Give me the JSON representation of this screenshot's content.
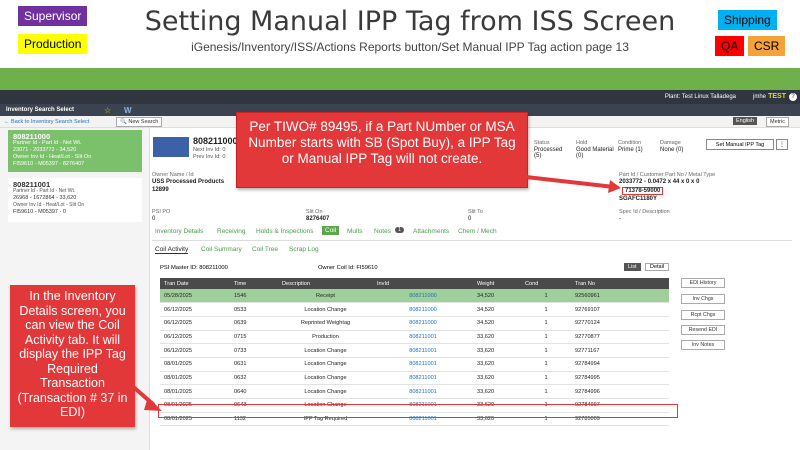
{
  "slide": {
    "title": "Setting Manual IPP Tag from ISS Screen",
    "subtitle": "iGenesis/Inventory/ISS/Actions Reports button/Set Manual IPP Tag action page 13",
    "roles_left": [
      "Supervisor",
      "Production"
    ],
    "roles_right": [
      "Shipping",
      "QA",
      "CSR"
    ]
  },
  "app": {
    "plant": "Plant: Test Linux Talladega",
    "user": "jmhe",
    "env": "TEST",
    "screen_title": "Inventory Search Select",
    "w_icon": "W",
    "back_link": "Back to Inventory Search Select",
    "new_search": "New Search",
    "lang": [
      "English",
      "Metric"
    ]
  },
  "sidebar": {
    "cards": [
      {
        "title": "808211000",
        "l1": "Partner Id - Part Id - Net Wt.",
        "l2": "23071 - 2033772 - 34,520",
        "l3": "Owner Inv Id - Heat/Lot - Slit On",
        "l4": "FI59610 - M05397 - 8276407"
      },
      {
        "title": "808211001",
        "l1": "Partner Id - Part Id - Net Wt.",
        "l2": "26968 - 1672864 - 33,620",
        "l3": "Owner Inv Id - Heat/Lot - Slit On",
        "l4": "FI59610 - M05397 - 0"
      }
    ]
  },
  "detail": {
    "inv_id": "808211000",
    "next_inv": "Next Inv Id: 0",
    "prev_inv": "Prev Inv Id: 0",
    "owner_label": "Owner Name / Id",
    "owner_name": "USS Processed Products",
    "owner_id": "12899",
    "status_label": "Status",
    "status_val": "Processed (5)",
    "hold_label": "Hold",
    "hold_val": "Good Material (0)",
    "cond_label": "Condition",
    "cond_val": "Prime (1)",
    "damage_label": "Damage",
    "damage_val": "None (0)",
    "set_manual_btn": "Set Manual IPP Tag",
    "part_label": "Part Id / Customer Part No / Metal Type",
    "part_val": "2033772 - 0.0472 x 44 x 0 x 0",
    "part_no": "71378-59000",
    "metal": "SGAFC1180Y",
    "psi_po_label": "PSI PO",
    "psi_po_val": "0",
    "slit_on_label": "Slit On",
    "slit_on_val": "8276407",
    "slit_to_label": "Slit To",
    "slit_to_val": "0",
    "spec_label": "Spec Id / Description",
    "spec_val": "-",
    "tabs": [
      "Inventory Details",
      "Receiving",
      "Holds & Inspections",
      "Coil",
      "Mults",
      "Notes",
      "Attachments",
      "Chem / Mech"
    ],
    "notes_count": "1",
    "subtabs": [
      "Coil Activity",
      "Coil Summary",
      "Coil Tree",
      "Scrap Log"
    ],
    "psi_master": "PSI Master ID: 808211000",
    "owner_coil": "Owner Coil Id: FI59610",
    "view_btns": [
      "List",
      "Detail"
    ]
  },
  "table": {
    "headers": [
      "Tran Date",
      "Time",
      "Description",
      "InvId",
      "Weight",
      "Cond",
      "Tran No"
    ],
    "rows": [
      [
        "05/28/2025",
        "1546",
        "Receipt",
        "808211000",
        "34,520",
        "1",
        "92560961"
      ],
      [
        "06/12/2025",
        "0533",
        "Location Change",
        "808211000",
        "34,520",
        "1",
        "92769107"
      ],
      [
        "06/12/2025",
        "0639",
        "Reprinted Weightag",
        "808211000",
        "34,520",
        "1",
        "92770124"
      ],
      [
        "06/12/2025",
        "0715",
        "Production",
        "808211001",
        "33,620",
        "1",
        "92770877"
      ],
      [
        "06/12/2025",
        "0733",
        "Location Change",
        "808211001",
        "33,620",
        "1",
        "92771167"
      ],
      [
        "08/01/2025",
        "0631",
        "Location Change",
        "808211001",
        "33,620",
        "1",
        "92784994"
      ],
      [
        "08/01/2025",
        "0632",
        "Location Change",
        "808211001",
        "33,620",
        "1",
        "92784995"
      ],
      [
        "08/01/2025",
        "0640",
        "Location Change",
        "808211001",
        "33,620",
        "1",
        "92784996"
      ],
      [
        "08/01/2025",
        "0643",
        "Location Change",
        "808211001",
        "33,620",
        "1",
        "92784997"
      ],
      [
        "08/01/2025",
        "1132",
        "IPP Tag Required",
        "808211001",
        "33,620",
        "1",
        "92785009"
      ]
    ],
    "side_buttons": [
      "EDI History",
      "Inv Chgs",
      "Rcpt Chgs",
      "Resend EDI",
      "Inv Notes"
    ]
  },
  "callouts": {
    "right": "Per TIWO# 89495, if a Part NUmber or MSA Number starts with SB (Spot Buy), a IPP Tag or Manual IPP Tag will not create.",
    "left": "In the Inventory Details screen, you can view the Coil Activity tab. It will display the IPP Tag Required Transaction (Transaction # 37 in EDI)"
  },
  "colors": {
    "accent_green": "#6fb04a",
    "callout_red": "#e2383a",
    "role_purple": "#7030a0",
    "role_yellow": "#ffff00",
    "role_cyan": "#00b0f0",
    "role_red": "#ff0000",
    "role_orange": "#f4a23a"
  }
}
